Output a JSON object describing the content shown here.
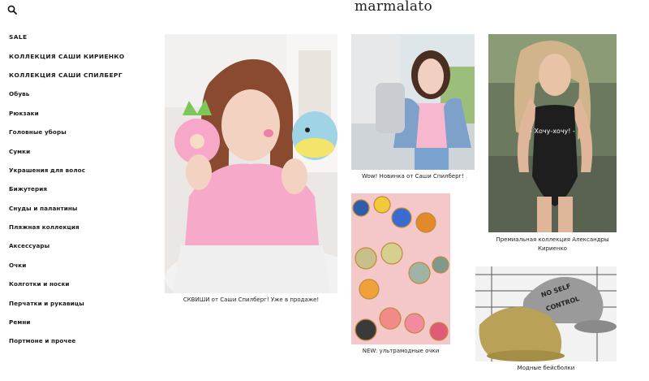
{
  "header": {
    "logo": "marmalato",
    "search_icon": "search-icon"
  },
  "sidebar": {
    "items": [
      {
        "label": "SALE"
      },
      {
        "label": "КОЛЛЕКЦИЯ САШИ КИРИЕНКО"
      },
      {
        "label": "КОЛЛЕКЦИЯ САШИ СПИЛБЕРГ"
      },
      {
        "label": "Обувь"
      },
      {
        "label": "Рюкзаки"
      },
      {
        "label": "Головные уборы"
      },
      {
        "label": "Сумки"
      },
      {
        "label": "Украшения для волос"
      },
      {
        "label": "Бижутерия"
      },
      {
        "label": "Снуды и палантины"
      },
      {
        "label": "Пляжная коллекция"
      },
      {
        "label": "Аксессуары"
      },
      {
        "label": "Очки"
      },
      {
        "label": "Колготки и носки"
      },
      {
        "label": "Перчатки и рукавицы"
      },
      {
        "label": "Ремни"
      },
      {
        "label": "Портмоне и прочее"
      }
    ]
  },
  "tiles": {
    "squishy": {
      "caption": "СКВИШИ от Саши Спилберг! Уже в продаже!"
    },
    "spilberg": {
      "caption": "Wow! Новинка от Саши Спилберг!"
    },
    "glasses": {
      "caption": "NEW: ультрамодные очки"
    },
    "kirienko": {
      "caption": "Премиальная коллекция Александры Кириенко",
      "overlay": "- Хочу-хочу! -"
    },
    "caps": {
      "caption": "Модные бейсболки",
      "cap_text_1": "NO SELF",
      "cap_text_2": "CONTROL"
    }
  },
  "colors": {
    "text": "#111111",
    "pink": "#f07aa8",
    "pink_bg": "#f4c7c9"
  }
}
